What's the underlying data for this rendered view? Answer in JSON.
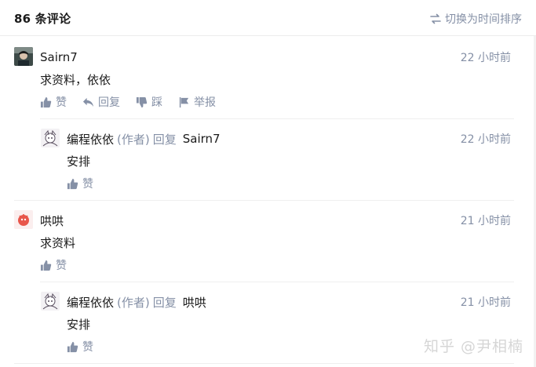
{
  "header": {
    "comment_count": "86 条评论",
    "sort_label": "切换为时间排序",
    "sort_icon": "swap-arrows-icon"
  },
  "comments": [
    {
      "author": "Sairn7",
      "time": "22 小时前",
      "content": "求资料，依依",
      "actions": {
        "like": "赞",
        "reply": "回复",
        "dislike": "踩",
        "report": "举报"
      },
      "replies": [
        {
          "author": "编程依依",
          "author_tag": "(作者)",
          "reply_word": "回复",
          "reply_to": "Sairn7",
          "time": "22 小时前",
          "content": "安排",
          "actions": {
            "like": "赞"
          }
        }
      ]
    },
    {
      "author": "哄哄",
      "time": "21 小时前",
      "content": "求资料",
      "actions": {
        "like": "赞"
      },
      "replies": [
        {
          "author": "编程依依",
          "author_tag": "(作者)",
          "reply_word": "回复",
          "reply_to": "哄哄",
          "time": "21 小时前",
          "content": "安排",
          "actions": {
            "like": "赞"
          }
        }
      ]
    }
  ],
  "watermark": "知乎 @尹相楠",
  "colors": {
    "text_primary": "#1a1a1a",
    "text_secondary": "#8590a6",
    "divider": "#efefef"
  }
}
